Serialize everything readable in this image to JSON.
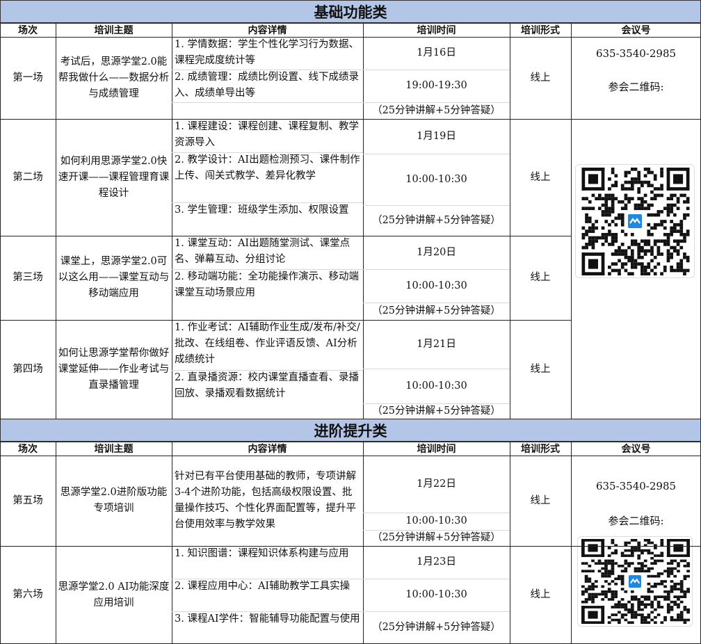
{
  "basic": {
    "section_title": "基础功能类",
    "headers": [
      "场次",
      "培训主题",
      "内容详情",
      "培训时间",
      "培训形式",
      "会议号"
    ],
    "meeting_id": "635-3540-2985",
    "qr_label": "参会二维码:",
    "sessions": [
      {
        "session": "第一场",
        "topic": "考试后，思源学堂2.0能帮我做什么——数据分析与成绩管理",
        "details": [
          "1. 学情数据：学生个性化学习行为数据、课程完成度统计等",
          "2. 成绩管理：成绩比例设置、线下成绩录入、成绩单导出等"
        ],
        "date": "1月16日",
        "time": "19:00-19:30",
        "note": "（25分钟讲解+5分钟答疑）",
        "format": "线上"
      },
      {
        "session": "第二场",
        "topic": "如何利用思源学堂2.0快速开课——课程管理育课程设计",
        "details": [
          "1. 课程建设：课程创建、课程复制、教学资源导入",
          "2. 教学设计：AI出题检测预习、课件制作上传、闯关式教学、差异化教学",
          "3. 学生管理：班级学生添加、权限设置"
        ],
        "date": "1月19日",
        "time": "10:00-10:30",
        "note": "（25分钟讲解+5分钟答疑）",
        "format": "线上"
      },
      {
        "session": "第三场",
        "topic": "课堂上，思源学堂2.0可以这么用——课堂互动与移动端应用",
        "details": [
          "1. 课堂互动：AI出题随堂测试、课堂点名、弹幕互动、分组讨论",
          "2. 移动端功能：全功能操作演示、移动端课堂互动场景应用"
        ],
        "date": "1月20日",
        "time": "10:00-10:30",
        "note": "（25分钟讲解+5分钟答疑）",
        "format": "线上"
      },
      {
        "session": "第四场",
        "topic": "如何让思源学堂帮你做好课堂延伸——作业考试与直录播管理",
        "details": [
          "1. 作业考试：AI辅助作业生成/发布/补交/批改、在线组卷、作业评语反馈、AI分析成绩统计",
          "2. 直录播资源：校内课堂直播查看、录播回放、录播观看数据统计"
        ],
        "date": "1月21日",
        "time": "10:00-10:30",
        "note": "（25分钟讲解+5分钟答疑）",
        "format": "线上"
      }
    ]
  },
  "advanced": {
    "section_title": "进阶提升类",
    "headers": [
      "场次",
      "培训主题",
      "内容详情",
      "培训时间",
      "培训形式",
      "会议号"
    ],
    "meeting_id": "635-3540-2985",
    "qr_label": "参会二维码:",
    "sessions": [
      {
        "session": "第五场",
        "topic": "思源学堂2.0进阶版功能专项培训",
        "details": [
          "针对已有平台使用基础的教师，专项讲解3-4个进阶功能，包括高级权限设置、批量操作技巧、个性化界面配置等，提升平台使用效率与教学效果"
        ],
        "date": "1月22日",
        "time": "10:00-10:30",
        "note": "（25分钟讲解+5分钟答疑）",
        "format": "线上"
      },
      {
        "session": "第六场",
        "topic": "思源学堂2.0 AI功能深度应用培训",
        "details": [
          "1. 知识图谱：课程知识体系构建与应用",
          "2. 课程应用中心：AI辅助教学工具实操",
          "3. 课程AI学件：智能辅导功能配置与使用"
        ],
        "date": "1月23日",
        "time": "10:00-10:30",
        "note": "（25分钟讲解+5分钟答疑）",
        "format": "线上"
      }
    ]
  },
  "colors": {
    "section_bg": "#b4c6e7",
    "qr_accent": "#1e88e5"
  },
  "icons": {
    "qr": "qr-code-icon",
    "logo": "meeting-logo-icon"
  }
}
